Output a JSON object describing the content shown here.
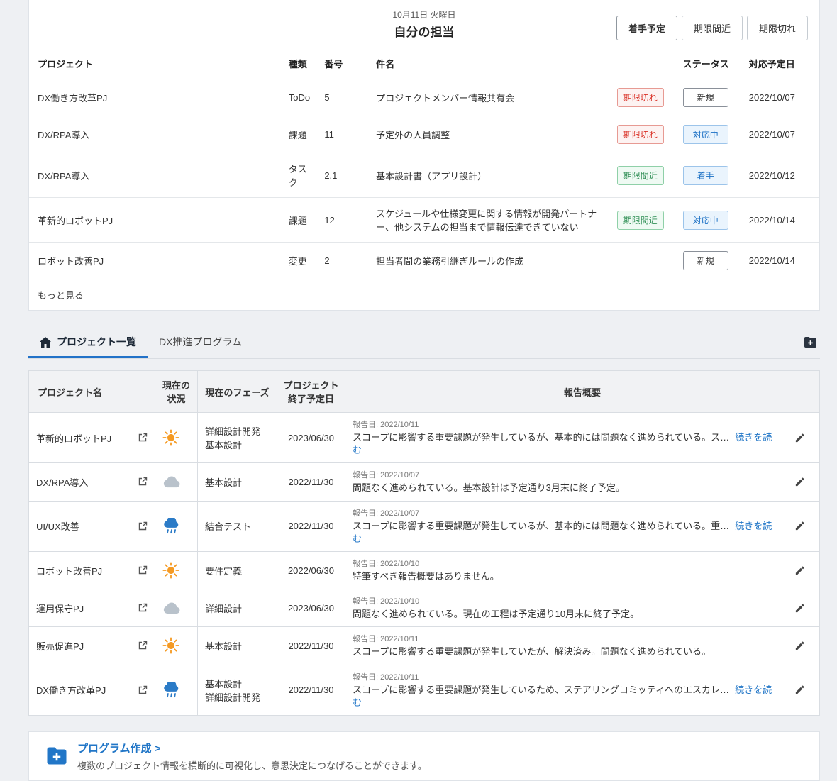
{
  "colors": {
    "accent_blue": "#2176c7",
    "danger_red": "#d93025",
    "warning_green": "#2f8f55",
    "status_active_blue": "#1a6fc4",
    "sun_orange": "#f59a23",
    "cloud_gray": "#b9c2cb",
    "rain_blue": "#2b7bc7",
    "tab_underline": "#2272c8"
  },
  "assignments": {
    "date": "10月11日 火曜日",
    "title": "自分の担当",
    "filters": [
      "着手予定",
      "期限間近",
      "期限切れ"
    ],
    "columns": {
      "project": "プロジェクト",
      "type": "種類",
      "number": "番号",
      "subject": "件名",
      "status": "ステータス",
      "due": "対応予定日"
    },
    "rows": [
      {
        "project": "DX働き方改革PJ",
        "type": "ToDo",
        "number": "5",
        "subject": "プロジェクトメンバー情報共有会",
        "deadline": "期限切れ",
        "status": "新規",
        "due": "2022/10/07"
      },
      {
        "project": "DX/RPA導入",
        "type": "課題",
        "number": "11",
        "subject": "予定外の人員調整",
        "deadline": "期限切れ",
        "status": "対応中",
        "due": "2022/10/07"
      },
      {
        "project": "DX/RPA導入",
        "type": "タスク",
        "number": "2.1",
        "subject": "基本設計書（アプリ設計）",
        "deadline": "期限間近",
        "status": "着手",
        "due": "2022/10/12"
      },
      {
        "project": "革新的ロボットPJ",
        "type": "課題",
        "number": "12",
        "subject": "スケジュールや仕様変更に関する情報が開発パートナー、他システムの担当まで情報伝達できていない",
        "deadline": "期限間近",
        "status": "対応中",
        "due": "2022/10/14"
      },
      {
        "project": "ロボット改善PJ",
        "type": "変更",
        "number": "2",
        "subject": "担当者間の業務引継ぎルールの作成",
        "deadline": "",
        "status": "新規",
        "due": "2022/10/14"
      }
    ],
    "more": "もっと見る"
  },
  "tabs": {
    "items": [
      {
        "label": "プロジェクト一覧",
        "active": true
      },
      {
        "label": "DX推進プログラム",
        "active": false
      }
    ]
  },
  "projects": {
    "columns": {
      "name": "プロジェクト名",
      "condition": "現在の\n状況",
      "phase": "現在のフェーズ",
      "end": "プロジェクト\n終了予定日",
      "summary": "報告概要"
    },
    "read_more": "続きを読む",
    "rows": [
      {
        "name": "革新的ロボットPJ",
        "weather": "sun",
        "phase": "詳細設計開発\n基本設計",
        "end": "2023/06/30",
        "report_date": "報告日: 2022/10/11",
        "summary": "スコープに影響する重要課題が発生しているが、基本的には問題なく進められている。ス…",
        "has_more": true
      },
      {
        "name": "DX/RPA導入",
        "weather": "cloud",
        "phase": "基本設計",
        "end": "2022/11/30",
        "report_date": "報告日: 2022/10/07",
        "summary": "問題なく進められている。基本設計は予定通り3月末に終了予定。",
        "has_more": false
      },
      {
        "name": "UI/UX改善",
        "weather": "rain",
        "phase": "結合テスト",
        "end": "2022/11/30",
        "report_date": "報告日: 2022/10/07",
        "summary": "スコープに影響する重要課題が発生しているが、基本的には問題なく進められている。重…",
        "has_more": true
      },
      {
        "name": "ロボット改善PJ",
        "weather": "sun",
        "phase": "要件定義",
        "end": "2022/06/30",
        "report_date": "報告日: 2022/10/10",
        "summary": "特筆すべき報告概要はありません。",
        "has_more": false
      },
      {
        "name": "運用保守PJ",
        "weather": "cloud",
        "phase": "詳細設計",
        "end": "2023/06/30",
        "report_date": "報告日: 2022/10/10",
        "summary": "問題なく進められている。現在の工程は予定通り10月末に終了予定。",
        "has_more": false
      },
      {
        "name": "販売促進PJ",
        "weather": "sun",
        "phase": "基本設計",
        "end": "2022/11/30",
        "report_date": "報告日: 2022/10/11",
        "summary": "スコープに影響する重要課題が発生していたが、解決済み。問題なく進められている。",
        "has_more": false
      },
      {
        "name": "DX働き方改革PJ",
        "weather": "rain",
        "phase": "基本設計\n詳細設計開発",
        "end": "2022/11/30",
        "report_date": "報告日: 2022/10/11",
        "summary": "スコープに影響する重要課題が発生しているため、ステアリングコミッティへのエスカレ…",
        "has_more": true
      }
    ]
  },
  "program_cta": {
    "title": "プログラム作成 >",
    "description": "複数のプロジェクト情報を横断的に可視化し、意思決定につなげることができます。"
  }
}
